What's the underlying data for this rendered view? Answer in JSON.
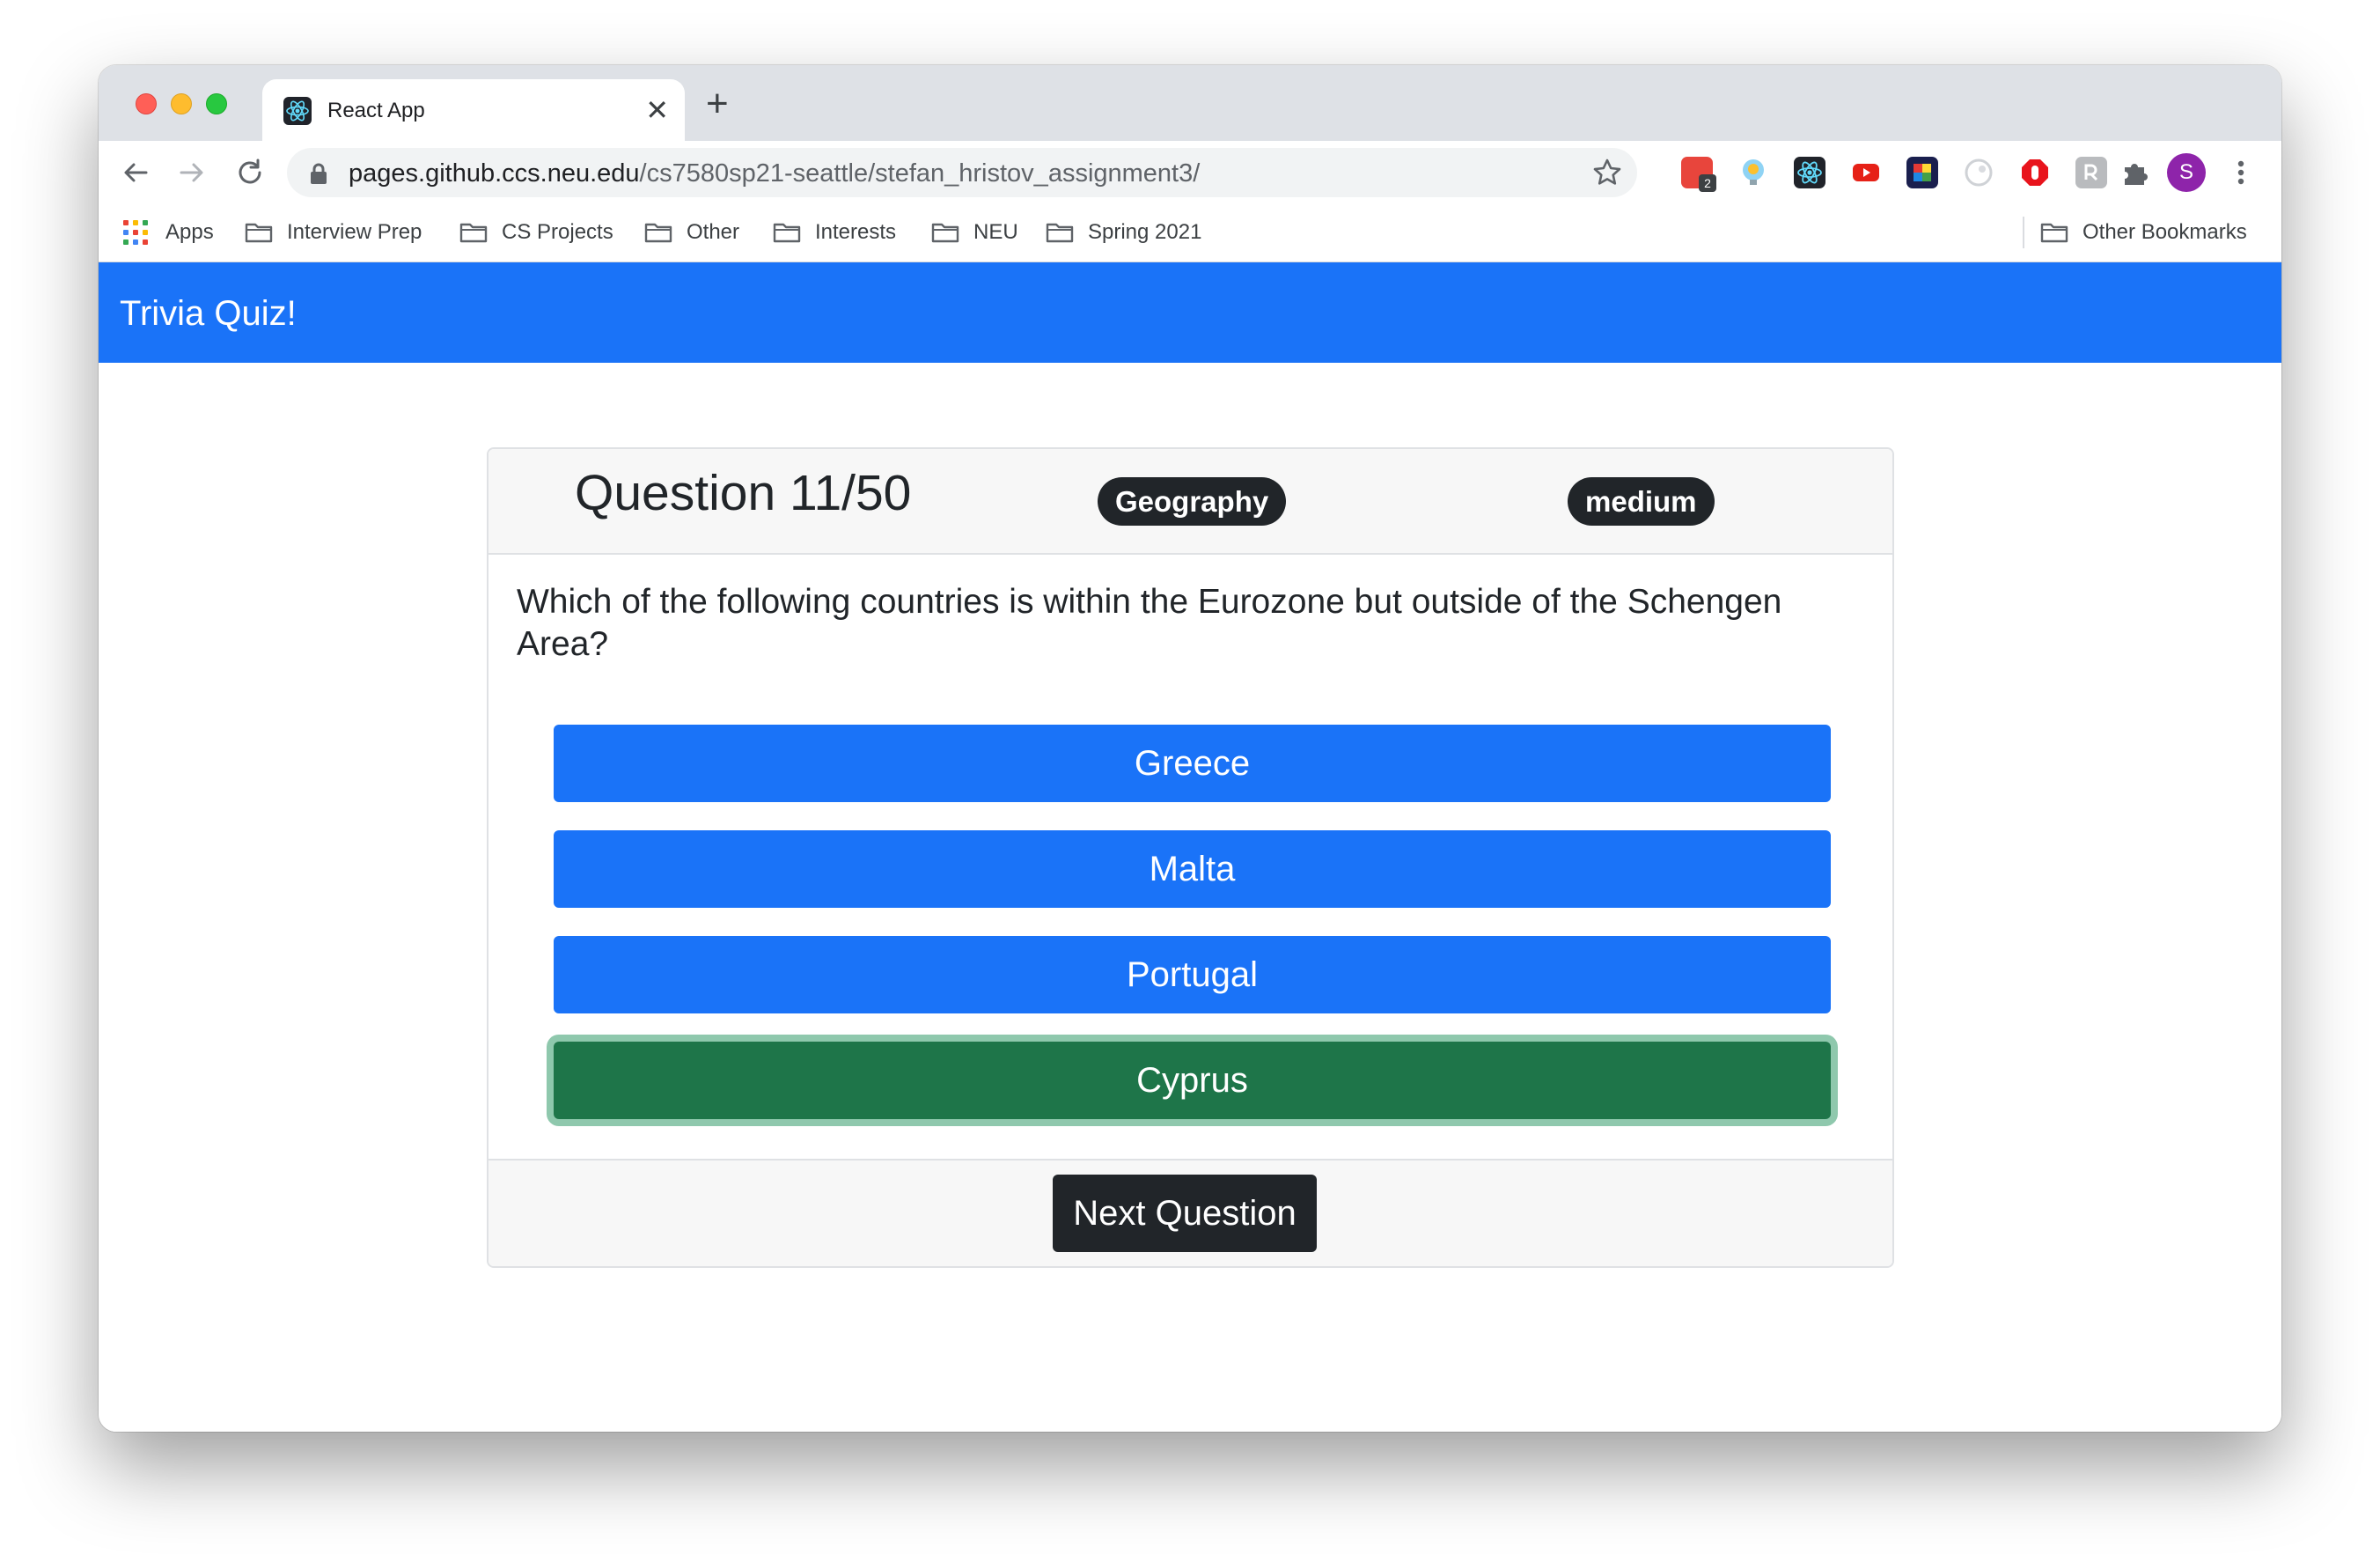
{
  "browser": {
    "tab": {
      "title": "React App",
      "close": "✕",
      "new_tab": "+"
    },
    "url": {
      "host": "pages.github.ccs.neu.edu",
      "path": "/cs7580sp21-seattle/stefan_hristov_assignment3/"
    },
    "extension_badge": "2",
    "avatar_letter": "S",
    "bookmarks": [
      {
        "label": "Apps",
        "icon": "apps-grid-icon"
      },
      {
        "label": "Interview Prep",
        "icon": "folder-icon"
      },
      {
        "label": "CS Projects",
        "icon": "folder-icon"
      },
      {
        "label": "Other",
        "icon": "folder-icon"
      },
      {
        "label": "Interests",
        "icon": "folder-icon"
      },
      {
        "label": "NEU",
        "icon": "folder-icon"
      },
      {
        "label": "Spring 2021",
        "icon": "folder-icon"
      }
    ],
    "other_bookmarks": "Other Bookmarks"
  },
  "app": {
    "brand": "Trivia Quiz!",
    "colors": {
      "primary": "#1a73f8",
      "correct": "#1e7549",
      "dark": "#212529"
    }
  },
  "quiz": {
    "question_label": "Question 11/50",
    "category": "Geography",
    "difficulty": "medium",
    "question": "Which of the following countries is within the Eurozone but outside of the Schengen Area?",
    "answers": [
      {
        "label": "Greece",
        "state": "default"
      },
      {
        "label": "Malta",
        "state": "default"
      },
      {
        "label": "Portugal",
        "state": "default"
      },
      {
        "label": "Cyprus",
        "state": "correct"
      }
    ],
    "next_label": "Next Question"
  }
}
